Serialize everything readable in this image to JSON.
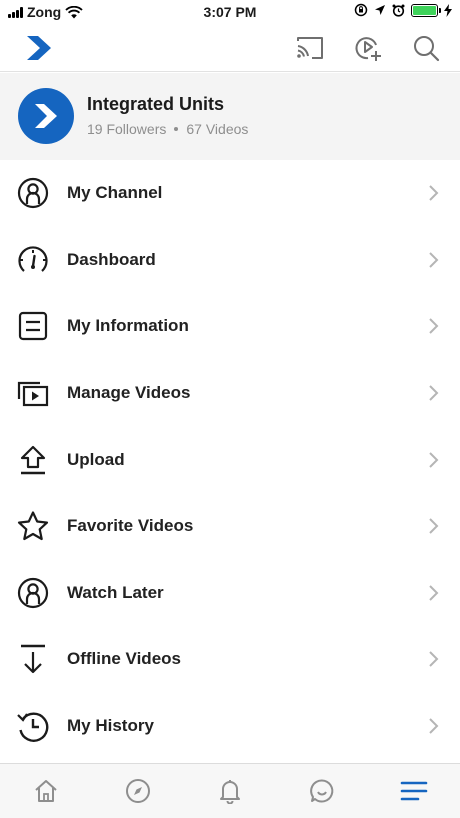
{
  "status": {
    "carrier": "Zong",
    "time": "3:07 PM",
    "battery_color": "#3ed35a"
  },
  "top_bar": {
    "logo_color": "#1565c0",
    "icons": [
      "cast-icon",
      "video-add-icon",
      "search-icon"
    ]
  },
  "profile": {
    "name": "Integrated Units",
    "followers": "19 Followers",
    "videos": "67 Videos",
    "avatar_color": "#1565c0"
  },
  "menu": {
    "items": [
      {
        "label": "My Channel",
        "icon": "user-circle-icon"
      },
      {
        "label": "Dashboard",
        "icon": "gauge-icon"
      },
      {
        "label": "My Information",
        "icon": "info-card-icon"
      },
      {
        "label": "Manage Videos",
        "icon": "video-stack-icon"
      },
      {
        "label": "Upload",
        "icon": "upload-icon"
      },
      {
        "label": "Favorite Videos",
        "icon": "star-icon"
      },
      {
        "label": "Watch Later",
        "icon": "user-circle-icon"
      },
      {
        "label": "Offline Videos",
        "icon": "download-icon"
      },
      {
        "label": "My History",
        "icon": "history-icon"
      }
    ]
  },
  "bottom_nav": {
    "items": [
      "home-icon",
      "compass-icon",
      "bell-icon",
      "chat-icon",
      "menu-icon"
    ],
    "active_color": "#1565c0",
    "inactive_color": "#8e8e8e"
  }
}
